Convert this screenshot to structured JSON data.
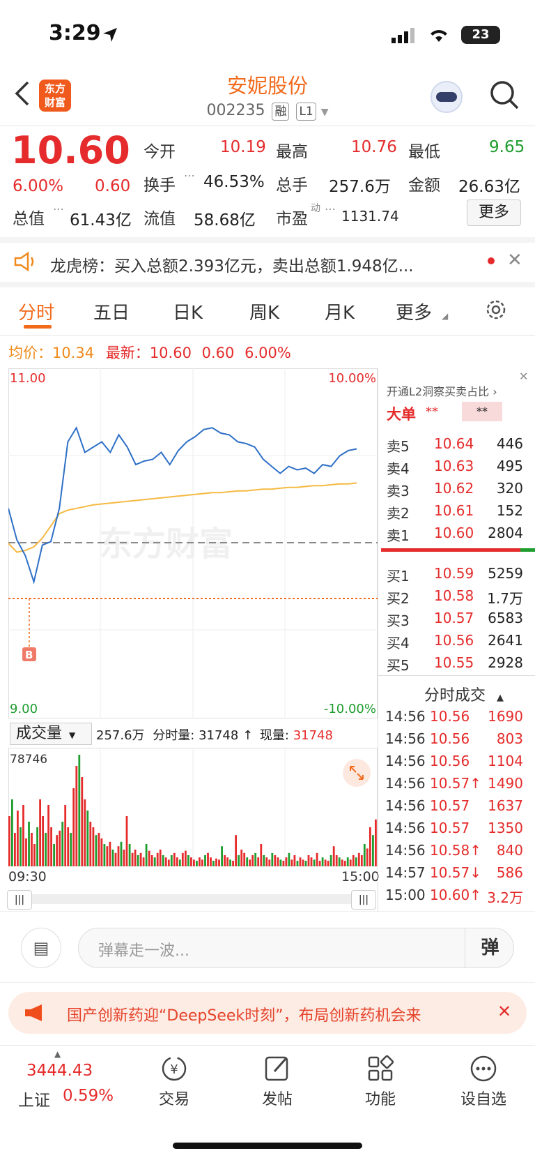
{
  "status_bar": {
    "time": "3:29",
    "battery": "23"
  },
  "header": {
    "stock_name": "安妮股份",
    "stock_code": "002235",
    "tag_rong": "融",
    "tag_l1": "L1",
    "logo_line1": "东方",
    "logo_line2": "财富"
  },
  "quote": {
    "price": "10.60",
    "change_pct": "6.00%",
    "change": "0.60",
    "open_label": "今开",
    "open": "10.19",
    "high_label": "最高",
    "high": "10.76",
    "low_label": "最低",
    "low": "9.65",
    "turnover_label": "换手",
    "turnover": "46.53%",
    "volume_label": "总手",
    "volume": "257.6万",
    "amount_label": "金额",
    "amount": "26.63亿",
    "mktcap_label": "总值",
    "mktcap": "61.43亿",
    "float_label": "流值",
    "float": "58.68亿",
    "pe_label": "市盈",
    "pe_sup": "动",
    "pe": "1131.74",
    "more_button": "更多"
  },
  "notice": {
    "text": "龙虎榜：买入总额2.393亿元，卖出总额1.948亿..."
  },
  "tabs": [
    "分时",
    "五日",
    "日K",
    "周K",
    "月K",
    "更多"
  ],
  "chart_info": {
    "avg_label": "均价：",
    "avg": "10.34",
    "latest_label": "最新：",
    "latest": "10.60",
    "chg": "0.60",
    "pct": "6.00%"
  },
  "chart_data": {
    "type": "line",
    "title": "",
    "y_top": "11.00",
    "y_bottom": "9.00",
    "pct_top": "10.00%",
    "pct_bottom": "-10.00%",
    "x_start": "09:30",
    "x_end": "15:00",
    "ylim": [
      9.0,
      11.0
    ],
    "watermark": "东方财富",
    "marker_label": "B",
    "series": [
      {
        "values": [
          10.2,
          10.02,
          9.93,
          9.78,
          9.99,
          10.01,
          10.2,
          10.58,
          10.66,
          10.52,
          10.55,
          10.58,
          10.52,
          10.62,
          10.55,
          10.45,
          10.47,
          10.48,
          10.52,
          10.45,
          10.53,
          10.58,
          10.61,
          10.65,
          10.66,
          10.63,
          10.62,
          10.58,
          10.57,
          10.55,
          10.48,
          10.44,
          10.4,
          10.44,
          10.42,
          10.43,
          10.4,
          10.45,
          10.44,
          10.5,
          10.53,
          10.54
        ]
      },
      {
        "values": [
          10.0,
          9.95,
          9.96,
          9.98,
          10.03,
          10.1,
          10.17,
          10.19,
          10.2,
          10.21,
          10.22,
          10.225,
          10.23,
          10.235,
          10.24,
          10.245,
          10.25,
          10.255,
          10.26,
          10.265,
          10.27,
          10.275,
          10.28,
          10.285,
          10.29,
          10.29,
          10.295,
          10.3,
          10.3,
          10.305,
          10.31,
          10.31,
          10.315,
          10.32,
          10.32,
          10.325,
          10.33,
          10.33,
          10.335,
          10.34,
          10.34,
          10.345
        ]
      }
    ],
    "volume_max_label": "78746",
    "volume_bars": [
      0.45,
      0.6,
      0.3,
      0.5,
      0.35,
      0.55,
      0.25,
      0.4,
      0.3,
      0.2,
      0.35,
      0.6,
      0.45,
      0.3,
      0.55,
      0.35,
      0.2,
      0.28,
      0.32,
      0.4,
      0.55,
      0.35,
      0.3,
      0.7,
      0.9,
      1.0,
      0.8,
      0.6,
      0.5,
      0.4,
      0.35,
      0.28,
      0.3,
      0.25,
      0.2,
      0.18,
      0.22,
      0.15,
      0.12,
      0.18,
      0.22,
      0.15,
      0.45,
      0.2,
      0.12,
      0.15,
      0.1,
      0.12,
      0.08,
      0.2,
      0.14,
      0.1,
      0.08,
      0.12,
      0.15,
      0.1,
      0.08,
      0.06,
      0.1,
      0.12,
      0.08,
      0.06,
      0.12,
      0.14,
      0.1,
      0.08,
      0.06,
      0.05,
      0.08,
      0.06,
      0.1,
      0.12,
      0.08,
      0.05,
      0.07,
      0.06,
      0.18,
      0.1,
      0.08,
      0.06,
      0.05,
      0.28,
      0.1,
      0.15,
      0.12,
      0.08,
      0.06,
      0.1,
      0.12,
      0.08,
      0.2,
      0.1,
      0.08,
      0.06,
      0.12,
      0.1,
      0.08,
      0.06,
      0.05,
      0.08,
      0.12,
      0.06,
      0.1,
      0.05,
      0.08,
      0.06,
      0.05,
      0.1,
      0.08,
      0.06,
      0.12,
      0.05,
      0.08,
      0.06,
      0.05,
      0.1,
      0.18,
      0.1,
      0.08,
      0.06,
      0.05,
      0.08,
      0.06,
      0.1,
      0.08,
      0.12,
      0.1,
      0.2,
      0.16,
      0.35,
      0.28,
      0.42
    ]
  },
  "volume_panel": {
    "selector": "成交量",
    "total": "257.6万",
    "minute_label": "分时量:",
    "minute": "31748",
    "now_label": "现量:",
    "now": "31748"
  },
  "order_book": {
    "promo": "开通L2洞察买卖占比",
    "big_label": "大单",
    "big_val1": "**",
    "big_val2": "**",
    "asks": [
      {
        "label": "卖5",
        "price": "10.64",
        "vol": "446"
      },
      {
        "label": "卖4",
        "price": "10.63",
        "vol": "495"
      },
      {
        "label": "卖3",
        "price": "10.62",
        "vol": "320"
      },
      {
        "label": "卖2",
        "price": "10.61",
        "vol": "152"
      },
      {
        "label": "卖1",
        "price": "10.60",
        "vol": "2804"
      }
    ],
    "bids": [
      {
        "label": "买1",
        "price": "10.59",
        "vol": "5259"
      },
      {
        "label": "买2",
        "price": "10.58",
        "vol": "1.7万"
      },
      {
        "label": "买3",
        "price": "10.57",
        "vol": "6583"
      },
      {
        "label": "买4",
        "price": "10.56",
        "vol": "2641"
      },
      {
        "label": "买5",
        "price": "10.55",
        "vol": "2928"
      }
    ]
  },
  "ticks": {
    "title": "分时成交",
    "rows": [
      {
        "time": "14:56",
        "price": "10.56",
        "vol": "1690",
        "dir": ""
      },
      {
        "time": "14:56",
        "price": "10.56",
        "vol": "803",
        "dir": ""
      },
      {
        "time": "14:56",
        "price": "10.56",
        "vol": "1104",
        "dir": ""
      },
      {
        "time": "14:56",
        "price": "10.57↑",
        "vol": "1490",
        "dir": ""
      },
      {
        "time": "14:56",
        "price": "10.57",
        "vol": "1637",
        "dir": ""
      },
      {
        "time": "14:56",
        "price": "10.57",
        "vol": "1350",
        "dir": ""
      },
      {
        "time": "14:56",
        "price": "10.58↑",
        "vol": "840",
        "dir": ""
      },
      {
        "time": "14:57",
        "price": "10.57↓",
        "vol": "586",
        "dir": "down"
      },
      {
        "time": "15:00",
        "price": "10.60↑",
        "vol": "3.2万",
        "dir": ""
      }
    ]
  },
  "comment_bar": {
    "placeholder": "弹幕走一波...",
    "danmu_button": "弹"
  },
  "banner": {
    "text": "国产创新药迎“DeepSeek时刻”，布局创新药机会来"
  },
  "bottom_nav": {
    "index_value": "3444.43",
    "index_name": "上证",
    "index_pct": "0.59%",
    "items": [
      "交易",
      "发帖",
      "功能",
      "设自选"
    ]
  },
  "colors": {
    "accent": "#f26b1d",
    "up": "#e52b2b",
    "down": "#1f9d2f",
    "price_line": "#2e6fc7",
    "avg_line": "#f5b942"
  }
}
